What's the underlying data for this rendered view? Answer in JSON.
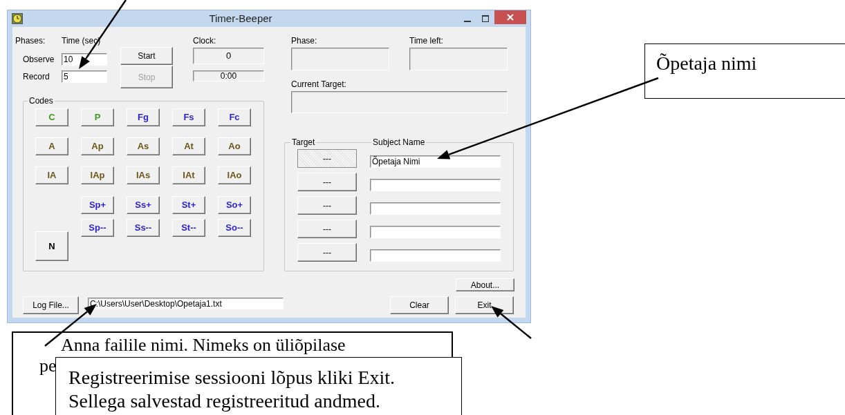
{
  "window": {
    "title": "Timer-Beeper"
  },
  "phases_label": "Phases:",
  "time_label": "Time (sec)",
  "phases": [
    {
      "label": "Observe",
      "value": "10"
    },
    {
      "label": "Record",
      "value": "5"
    }
  ],
  "start_button": {
    "label": "Start",
    "disabled": false
  },
  "stop_button": {
    "label": "Stop",
    "disabled": true
  },
  "clock": {
    "label": "Clock:",
    "count": "0",
    "time": "0:00"
  },
  "phase": {
    "label": "Phase:"
  },
  "time_left": {
    "label": "Time left:"
  },
  "current_target": {
    "label": "Current Target:"
  },
  "codes": {
    "title": "Codes",
    "rows": [
      [
        {
          "label": "C",
          "color": "#3c9a1e"
        },
        {
          "label": "P",
          "color": "#3c9a1e"
        },
        {
          "label": "Fg",
          "color": "#2a1fd0"
        },
        {
          "label": "Fs",
          "color": "#2a1fd0"
        },
        {
          "label": "Fc",
          "color": "#2a1fd0"
        }
      ],
      [
        {
          "label": "A",
          "color": "#6b5516"
        },
        {
          "label": "Ap",
          "color": "#6b5516"
        },
        {
          "label": "As",
          "color": "#6b5516"
        },
        {
          "label": "At",
          "color": "#6b5516"
        },
        {
          "label": "Ao",
          "color": "#6b5516"
        }
      ],
      [
        {
          "label": "IA",
          "color": "#6b5516"
        },
        {
          "label": "IAp",
          "color": "#6b5516"
        },
        {
          "label": "IAs",
          "color": "#6b5516"
        },
        {
          "label": "IAt",
          "color": "#6b5516"
        },
        {
          "label": "IAo",
          "color": "#6b5516"
        }
      ]
    ],
    "n_button": {
      "label": "N",
      "color": "#000000"
    },
    "sign_rows": [
      [
        {
          "label": "Sp+",
          "color": "#2a1fd0"
        },
        {
          "label": "Ss+",
          "color": "#2a1fd0"
        },
        {
          "label": "St+",
          "color": "#2a1fd0"
        },
        {
          "label": "So+",
          "color": "#2a1fd0"
        }
      ],
      [
        {
          "label": "Sp--",
          "color": "#2a1fd0"
        },
        {
          "label": "Ss--",
          "color": "#2a1fd0"
        },
        {
          "label": "St--",
          "color": "#2a1fd0"
        },
        {
          "label": "So--",
          "color": "#2a1fd0"
        }
      ]
    ]
  },
  "targets": {
    "target_title": "Target",
    "subject_title": "Subject Name",
    "rows": [
      {
        "button": "---",
        "selected": true,
        "subject": "Õpetaja Nimi"
      },
      {
        "button": "---",
        "selected": false
      },
      {
        "button": "---",
        "selected": false
      },
      {
        "button": "---",
        "selected": false
      },
      {
        "button": "---",
        "selected": false
      }
    ]
  },
  "about_button": "About...",
  "log_file_button": "Log File...",
  "log_path": "C:\\Users\\User\\Desktop\\Opetaja1.txt",
  "clear_button": "Clear",
  "exit_button": "Exit",
  "teacher_note": "Õpetaja nimi",
  "file_note": "Anna failile nimi. Nimeks on üliõpilase pe",
  "exit_note": "Registreerimise sessiooni lõpus kliki Exit. Sellega salvestad registreeritud andmed."
}
